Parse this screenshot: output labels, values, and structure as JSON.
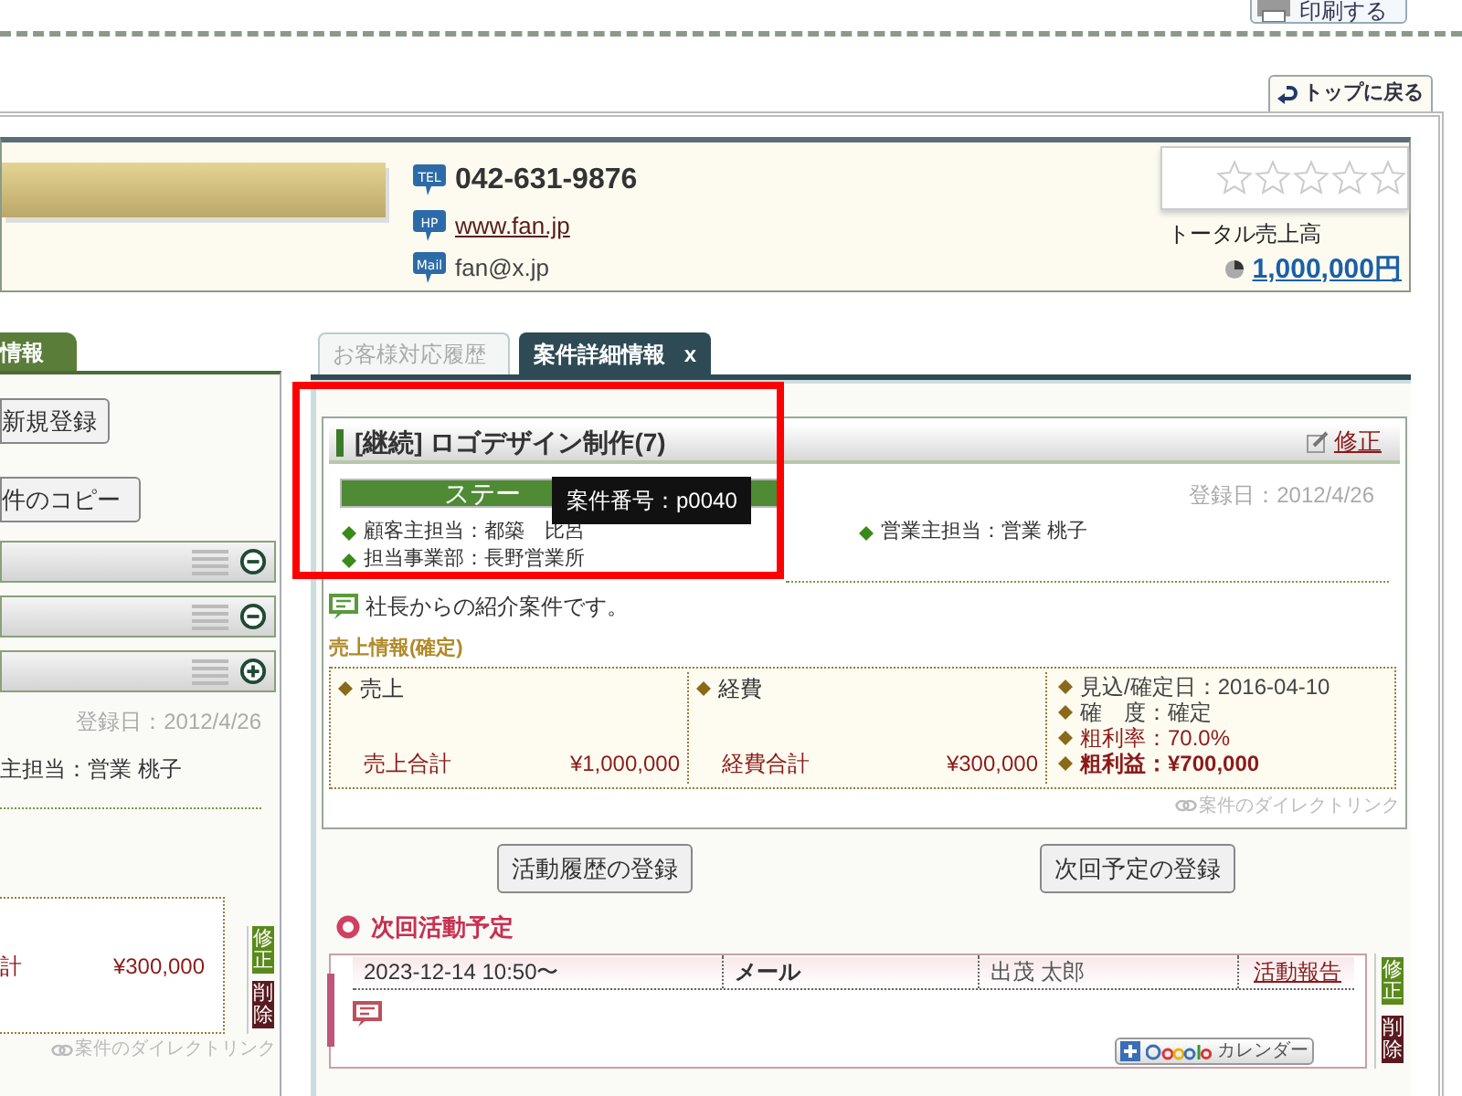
{
  "print_button": {
    "label": "印刷する"
  },
  "back_link": {
    "label": "トップに戻る"
  },
  "customer": {
    "icon_labels": [
      "TEL",
      "HP",
      "Mail"
    ],
    "tel": "042-631-9876",
    "homepage": "www.fan.jp",
    "mail": "fan@x.jp",
    "rating": {
      "stars": 0
    },
    "total_sales_label": "トータル売上高",
    "total_sales": "1,000,000円"
  },
  "left_panel": {
    "tab": "情報",
    "buttons": [
      "新規登録",
      "件のコピー"
    ],
    "sections": [
      {
        "expanded": true
      },
      {
        "expanded": true
      },
      {
        "expanded": false
      }
    ],
    "registered": "登録日：2012/4/26",
    "sales_rep": "主担当：営業 桃子",
    "cost_total_label": "計",
    "cost_total": "¥300,000",
    "edit": "修正",
    "delete": "削除",
    "direct_link": "案件のダイレクトリンク"
  },
  "tabs": [
    {
      "label": "お客様対応履歴",
      "selected": false
    },
    {
      "label": "案件詳細情報",
      "selected": true,
      "close": "x"
    }
  ],
  "deal": {
    "title": "[継続] ロゴデザイン制作(7)",
    "edit": "修正",
    "status": "ステー",
    "tooltip": "案件番号：p0040",
    "registered": "登録日：2012/4/26",
    "customer_rep": "顧客主担当：都築　比呂",
    "sales_rep": "営業主担当：営業 桃子",
    "department": "担当事業部：長野営業所",
    "comment": "社長からの紹介案件です。",
    "sales_heading": "売上情報(確定)",
    "sales": {
      "label": "売上",
      "total_label": "売上合計",
      "total": "¥1,000,000"
    },
    "costs": {
      "label": "経費",
      "total_label": "経費合計",
      "total": "¥300,000"
    },
    "facts": [
      {
        "text": "見込/確定日：2016-04-10",
        "kind": "plain"
      },
      {
        "text": "確　度：確定",
        "kind": "plain"
      },
      {
        "text": "粗利率：70.0%",
        "kind": "accent"
      },
      {
        "text": "粗利益：¥700,000",
        "kind": "strong"
      }
    ],
    "direct_link": "案件のダイレクトリンク"
  },
  "actions": [
    "活動履歴の登録",
    "次回予定の登録"
  ],
  "next_activity": {
    "heading": "次回活動予定",
    "items": [
      {
        "datetime": "2023-12-14 10:50〜",
        "type": "メール",
        "person": "出茂 太郎",
        "report": "活動報告",
        "calendar": "カレンダー",
        "edit": "修正",
        "delete": "削除"
      }
    ]
  }
}
